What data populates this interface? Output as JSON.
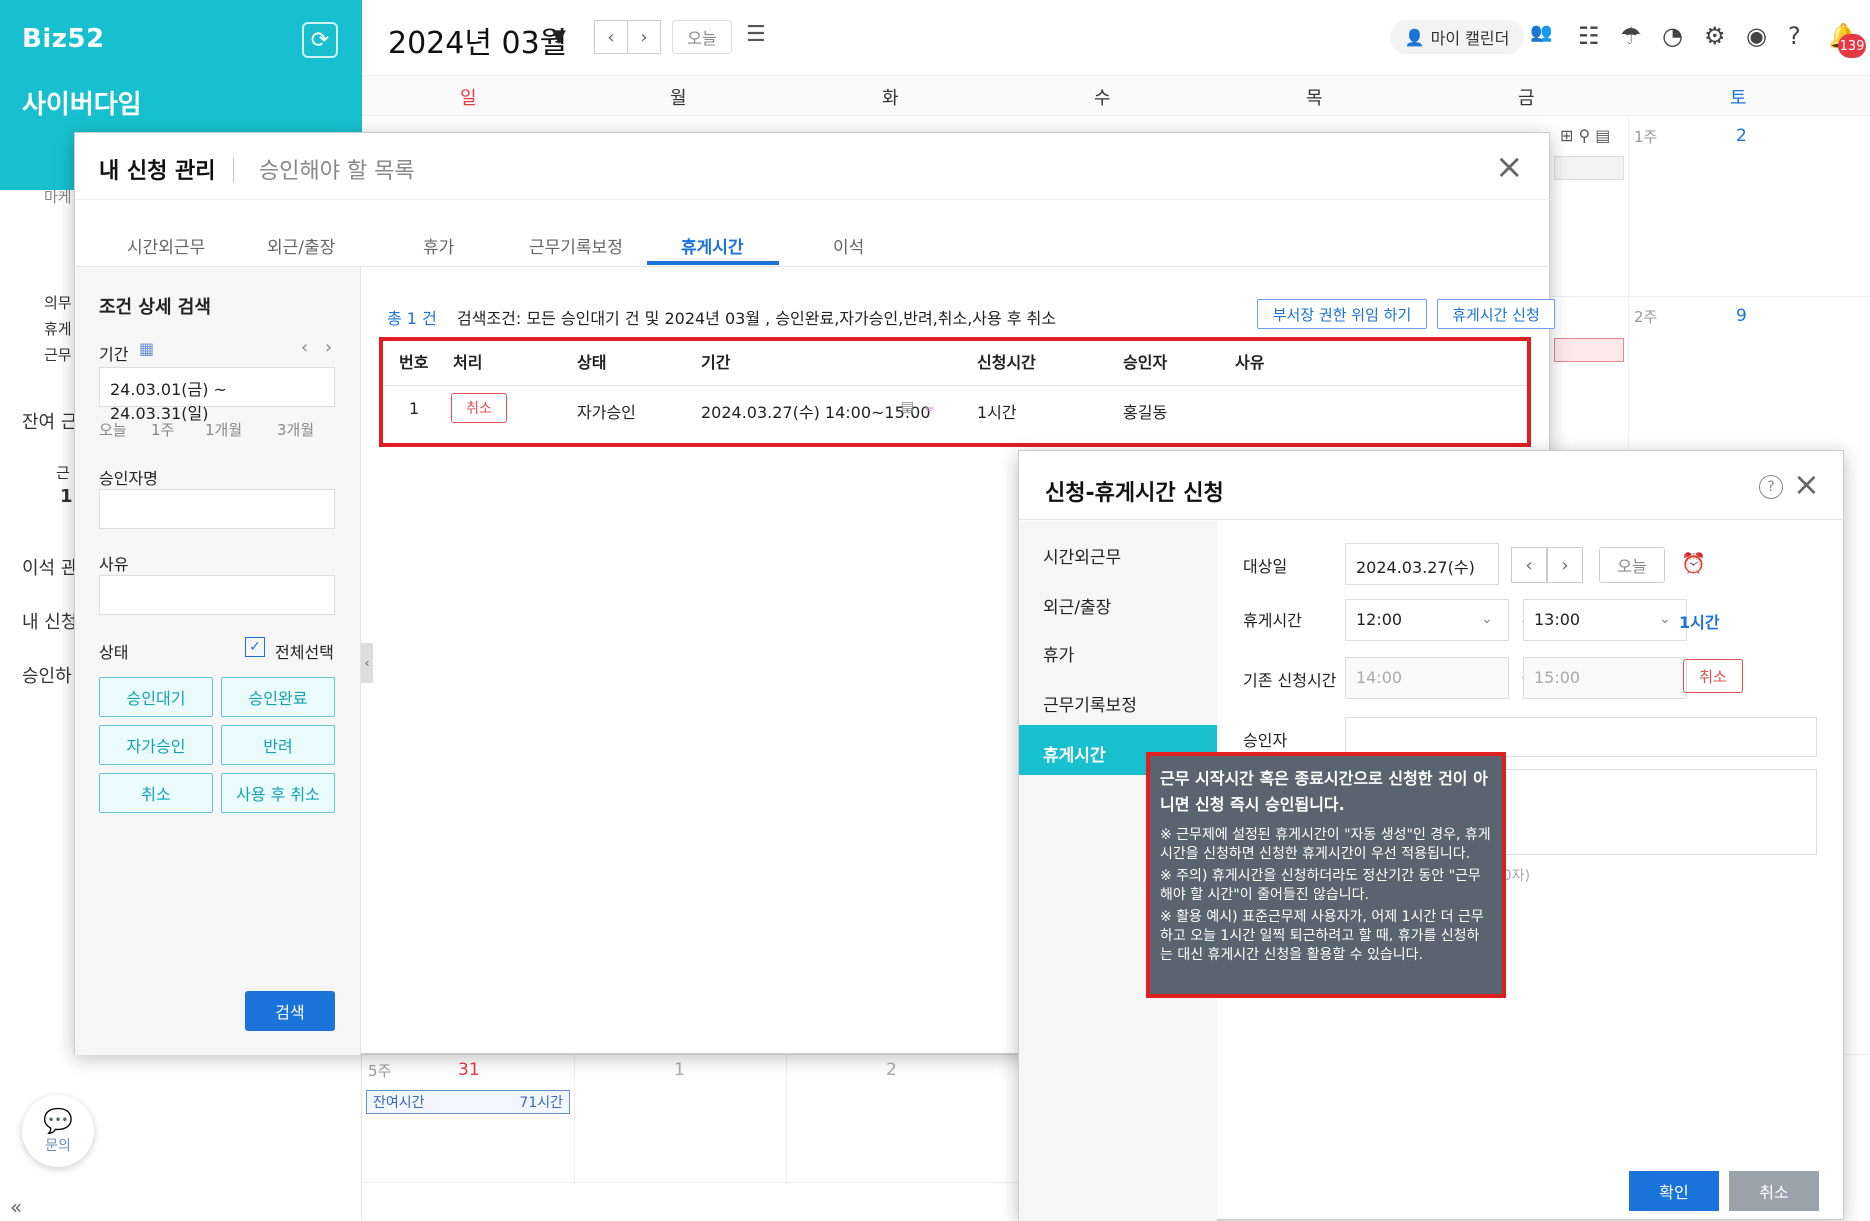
{
  "app": {
    "logo": "Biz52",
    "company": "사이버다임"
  },
  "sidebar_fragments": [
    "마케",
    "의무",
    "휴게",
    "근무",
    "잔여 근",
    "근",
    "1",
    "이석 관",
    "내 신청",
    "승인하"
  ],
  "inquiry_label": "문의",
  "calendar": {
    "month": "2024년 03월",
    "today": "오늘",
    "my_calendar": "마이 캘린더",
    "notification_count": "139",
    "weekdays": [
      "일",
      "월",
      "화",
      "수",
      "목",
      "금",
      "토"
    ],
    "week_labels": [
      "1주",
      "2주",
      "5주"
    ],
    "day_numbers": [
      "2",
      "9",
      "31",
      "1",
      "2"
    ],
    "remaining": {
      "label": "잔여시간",
      "value": "71시간"
    }
  },
  "modal1": {
    "title": "내 신청 관리",
    "subtitle": "승인해야 할 목록",
    "tabs": [
      "시간외근무",
      "외근/출장",
      "휴가",
      "근무기록보정",
      "휴게시간",
      "이석"
    ],
    "active_tab": "휴게시간",
    "filter": {
      "title": "조건 상세 검색",
      "period_label": "기간",
      "period_value": "24.03.01(금) ~ 24.03.31(일)",
      "quick": [
        "오늘",
        "1주",
        "1개월",
        "3개월"
      ],
      "approver_label": "승인자명",
      "reason_label": "사유",
      "status_label": "상태",
      "select_all": "전체선택",
      "status_buttons": [
        "승인대기",
        "승인완료",
        "자가승인",
        "반려",
        "취소",
        "사용 후 취소"
      ],
      "search": "검색"
    },
    "summary": {
      "total": "총 1 건",
      "condition": "검색조건: 모든 승인대기 건 및 2024년 03월 , 승인완료,자가승인,반려,취소,사용 후 취소"
    },
    "buttons": {
      "delegate": "부서장 권한 위임 하기",
      "apply_break": "휴게시간 신청"
    },
    "table": {
      "headers": [
        "번호",
        "처리",
        "상태",
        "기간",
        "신청시간",
        "승인자",
        "사유"
      ],
      "rows": [
        {
          "no": "1",
          "action": "취소",
          "status": "자가승인",
          "period": "2024.03.27(수) 14:00~15:00",
          "time": "1시간",
          "approver": "홍길동",
          "reason": ""
        }
      ]
    }
  },
  "modal2": {
    "title": "신청-휴게시간 신청",
    "nav": [
      "시간외근무",
      "외근/출장",
      "휴가",
      "근무기록보정",
      "휴게시간"
    ],
    "target_label": "대상일",
    "target_date": "2024.03.27(수)",
    "today": "오늘",
    "break_label": "휴게시간",
    "break_start": "12:00",
    "break_end": "13:00",
    "break_duration": "1시간",
    "prev_label": "기존 신청시간",
    "prev_start": "14:00",
    "prev_end": "15:00",
    "prev_cancel": "취소",
    "approver_label": "승인자",
    "char_count": "(0자/300자)",
    "confirm": "확인",
    "cancel": "취소",
    "tilde": "~"
  },
  "tooltip": {
    "main": "근무 시작시간 혹은 종료시간으로 신청한 건이 아니면 신청 즉시 승인됩니다.",
    "notes": [
      "※ 근무제에 설정된 휴게시간이 \"자동 생성\"인 경우, 휴게시간을 신청하면 신청한 휴게시간이 우선 적용됩니다.",
      "※ 주의) 휴게시간을 신청하더라도 정산기간 동안 \"근무해야 할 시간\"이 줄어들진 않습니다.",
      "※ 활용 예시) 표준근무제 사용자가, 어제 1시간 더 근무하고 오늘 1시간 일찍 퇴근하려고 할 때, 휴가를 신청하는 대신 휴게시간 신청을 활용할 수 있습니다."
    ]
  },
  "colors": {
    "accent": "#18c0cf",
    "primary": "#1a73d9",
    "highlight": "#e02020",
    "sunday": "#e63946",
    "saturday": "#1a73d9"
  }
}
